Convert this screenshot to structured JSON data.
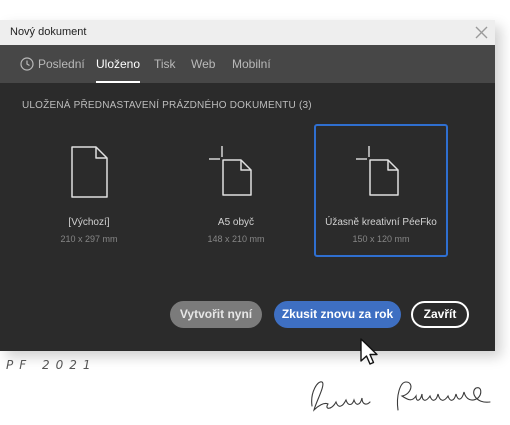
{
  "window": {
    "title": "Nový dokument"
  },
  "tabs": [
    {
      "label": "Poslední",
      "icon": "clock-icon"
    },
    {
      "label": "Uloženo",
      "active": true
    },
    {
      "label": "Tisk"
    },
    {
      "label": "Web"
    },
    {
      "label": "Mobilní"
    }
  ],
  "section": {
    "heading": "ULOŽENÁ PŘEDNASTAVENÍ PRÁZDNÉHO DOKUMENTU  (3)"
  },
  "presets": [
    {
      "name": "[Výchozí]",
      "size": "210 x 297 mm",
      "icon": "document-icon",
      "selected": false
    },
    {
      "name": "A5 obyč",
      "size": "148 x 210 mm",
      "icon": "document-with-crop-marks-icon",
      "selected": false
    },
    {
      "name": "Úžasně kreativní PéeFko",
      "size": "150 x 120 mm",
      "icon": "document-with-crop-marks-icon",
      "selected": true
    }
  ],
  "buttons": {
    "create": "Vytvořit nyní",
    "retry": "Zkusit znovu za rok",
    "close": "Zavřít"
  },
  "footer": {
    "greeting": "PF 2021",
    "signature": "Lenka Pittner"
  },
  "colors": {
    "accent": "#2f6fd0",
    "primary_button": "#3e6fc2",
    "dialog_bg": "#2b2b2b",
    "tabbar_bg": "#474747"
  }
}
